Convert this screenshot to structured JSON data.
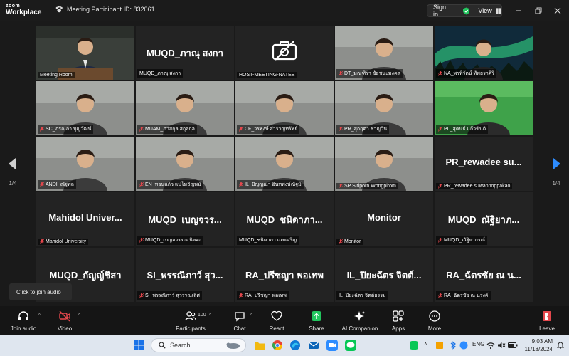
{
  "titlebar": {
    "brand_line1": "zoom",
    "brand_line2": "Workplace",
    "meeting_id": "Meeting Participant ID: 832061",
    "signin_label": "Sign in",
    "view_label": "View"
  },
  "colors": {
    "active_speaker": "#2ecc71",
    "mic_muted": "#e5484d",
    "shield": "#22c55e",
    "share_green": "#22c55e",
    "leave_red": "#e5484d",
    "nav_arrow": "#2d8cff"
  },
  "nav": {
    "left_page": "1/4",
    "right_page": "1/4"
  },
  "tiles": [
    {
      "big": "",
      "name": "Meeting Room",
      "muted": false,
      "active": true,
      "video": "room"
    },
    {
      "big": "MUQD_ภาณุ สงกา",
      "name": "MUQD_ภาณุ สงกา",
      "muted": false,
      "active": false,
      "video": ""
    },
    {
      "big": "",
      "name": "HOST-MEETING-NATEE",
      "muted": false,
      "active": false,
      "video": "camoff"
    },
    {
      "big": "",
      "name": "DT_มณฑิรา ชัยชนะมงคล",
      "muted": true,
      "active": false,
      "video": "person"
    },
    {
      "big": "",
      "name": "NA_พรพิรัตน์ ทัพธราศิริ",
      "muted": true,
      "active": false,
      "video": "aurora"
    },
    {
      "big": "",
      "name": "SC_ภรณภา บุญวัฒน์",
      "muted": true,
      "active": false,
      "video": "person"
    },
    {
      "big": "",
      "name": "MUAM_ภาสกุล สกุลกุล",
      "muted": true,
      "active": false,
      "video": "person"
    },
    {
      "big": "",
      "name": "CF_วรพงษ์ สำราญทรัพย์",
      "muted": true,
      "active": false,
      "video": "person"
    },
    {
      "big": "",
      "name": "PR_สุกฤตา ชาญวิน",
      "muted": true,
      "active": false,
      "video": "person"
    },
    {
      "big": "",
      "name": "PL_สุคนธ์ แก้วขันติ",
      "muted": true,
      "active": false,
      "video": "green"
    },
    {
      "big": "",
      "name": "ANDI_ณัฐพล",
      "muted": true,
      "active": false,
      "video": "person"
    },
    {
      "big": "",
      "name": "EN_ทอนแก้ว แปโมธิญพม์",
      "muted": true,
      "active": false,
      "video": "person"
    },
    {
      "big": "",
      "name": "IL_ปัญญณา อินทพงษ์ณัฐม์",
      "muted": true,
      "active": false,
      "video": "person"
    },
    {
      "big": "",
      "name": "SP Siriporn Wongpirom",
      "muted": true,
      "active": false,
      "video": "person"
    },
    {
      "big": "PR_rewadee su...",
      "name": "PR_rewadee suwannoppakao",
      "muted": true,
      "active": false,
      "video": ""
    },
    {
      "big": "Mahidol Univer...",
      "name": "Mahidol University",
      "muted": true,
      "active": false,
      "video": ""
    },
    {
      "big": "MUQD_เบญจวร...",
      "name": "MUQD_เบญจวรรณ นิลคง",
      "muted": true,
      "active": false,
      "video": ""
    },
    {
      "big": "MUQD_ชนิดาภา...",
      "name": "MUQD_ชนิดาภา เฉยเจริญ",
      "muted": false,
      "active": false,
      "video": ""
    },
    {
      "big": "Monitor",
      "name": "Monitor",
      "muted": true,
      "active": false,
      "video": ""
    },
    {
      "big": "MUQD_ณัฐิยาภ...",
      "name": "MUQD_ณัฐิยากรณ์",
      "muted": true,
      "active": false,
      "video": ""
    },
    {
      "big": "MUQD_กัญญ์ชิสา",
      "name": "",
      "muted": false,
      "active": false,
      "video": ""
    },
    {
      "big": "SI_พรรณิภาว์ สุว...",
      "name": "SI_พรรณิภาว์ สุวรรณเลิศ",
      "muted": true,
      "active": false,
      "video": ""
    },
    {
      "big": "RA_ปรีชญา พอเทพ",
      "name": "RA_ปรีชญา พอเทพ",
      "muted": true,
      "active": false,
      "video": ""
    },
    {
      "big": "IL_ปิยะฉัตร จิตต์...",
      "name": "IL_ปิยะฉัตร จิตต์ธรรม",
      "muted": false,
      "active": false,
      "video": ""
    },
    {
      "big": "RA_ฉัตรชัย ณ น...",
      "name": "RA_ฉัตรชัย ณ นรงค์",
      "muted": true,
      "active": false,
      "video": ""
    }
  ],
  "tooltip": "Click to join audio",
  "toolbar": {
    "join_audio": "Join audio",
    "video": "Video",
    "participants": "Participants",
    "participants_count": "100",
    "chat": "Chat",
    "react": "React",
    "share": "Share",
    "ai_companion": "AI Companion",
    "apps": "Apps",
    "more": "More",
    "leave": "Leave"
  },
  "taskbar": {
    "search_placeholder": "Search",
    "lang": "ENG",
    "time": "9:03 AM",
    "date": "11/18/2024"
  }
}
